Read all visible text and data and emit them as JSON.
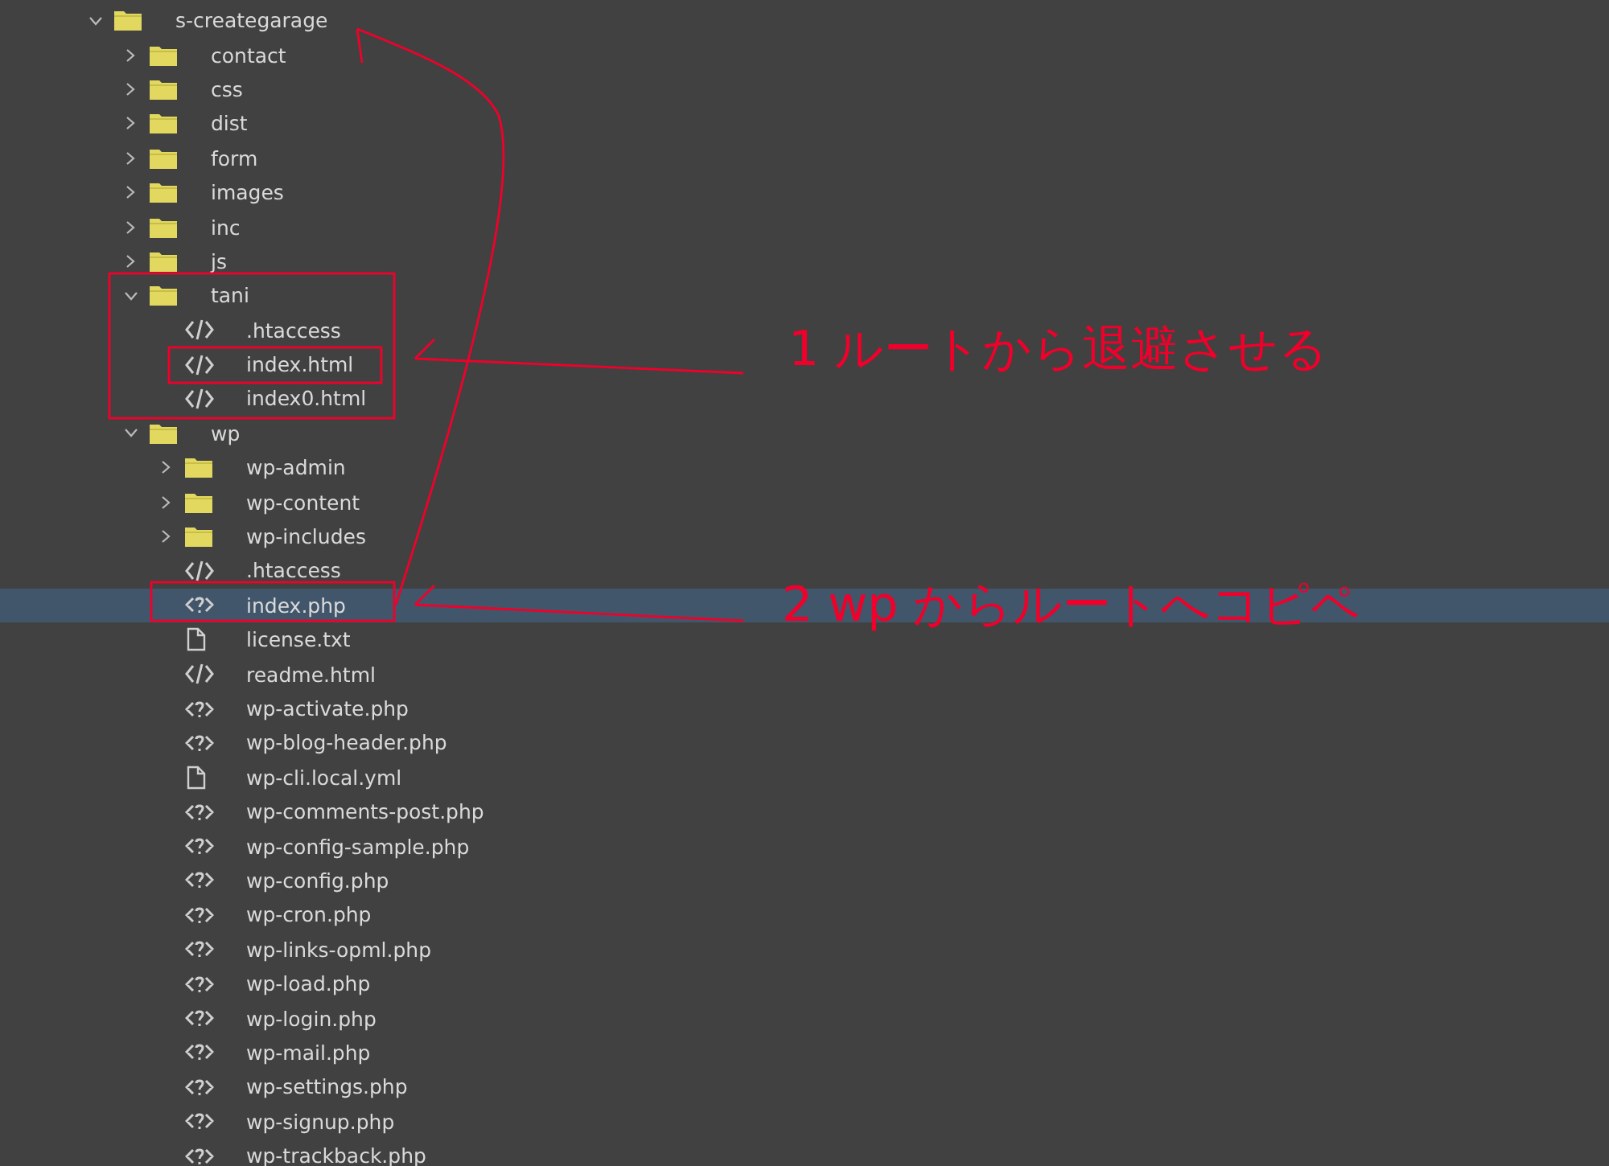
{
  "tree": [
    {
      "name": "s-creategarage",
      "kind": "folder",
      "expanded": true,
      "selected": false,
      "children": [
        {
          "name": "contact",
          "kind": "folder",
          "expanded": false,
          "selected": false
        },
        {
          "name": "css",
          "kind": "folder",
          "expanded": false,
          "selected": false
        },
        {
          "name": "dist",
          "kind": "folder",
          "expanded": false,
          "selected": false
        },
        {
          "name": "form",
          "kind": "folder",
          "expanded": false,
          "selected": false
        },
        {
          "name": "images",
          "kind": "folder",
          "expanded": false,
          "selected": false
        },
        {
          "name": "inc",
          "kind": "folder",
          "expanded": false,
          "selected": false
        },
        {
          "name": "js",
          "kind": "folder",
          "expanded": false,
          "selected": false
        },
        {
          "name": "tani",
          "kind": "folder",
          "expanded": true,
          "selected": false,
          "children": [
            {
              "name": ".htaccess",
              "kind": "markup",
              "selected": false
            },
            {
              "name": "index.html",
              "kind": "markup",
              "selected": false
            },
            {
              "name": "index0.html",
              "kind": "markup",
              "selected": false
            }
          ]
        },
        {
          "name": "wp",
          "kind": "folder",
          "expanded": true,
          "selected": false,
          "children": [
            {
              "name": "wp-admin",
              "kind": "folder",
              "expanded": false,
              "selected": false
            },
            {
              "name": "wp-content",
              "kind": "folder",
              "expanded": false,
              "selected": false
            },
            {
              "name": "wp-includes",
              "kind": "folder",
              "expanded": false,
              "selected": false
            },
            {
              "name": ".htaccess",
              "kind": "markup",
              "selected": false
            },
            {
              "name": "index.php",
              "kind": "php",
              "selected": true
            },
            {
              "name": "license.txt",
              "kind": "text",
              "selected": false
            },
            {
              "name": "readme.html",
              "kind": "markup",
              "selected": false
            },
            {
              "name": "wp-activate.php",
              "kind": "php",
              "selected": false
            },
            {
              "name": "wp-blog-header.php",
              "kind": "php",
              "selected": false
            },
            {
              "name": "wp-cli.local.yml",
              "kind": "text",
              "selected": false
            },
            {
              "name": "wp-comments-post.php",
              "kind": "php",
              "selected": false
            },
            {
              "name": "wp-config-sample.php",
              "kind": "php",
              "selected": false
            },
            {
              "name": "wp-config.php",
              "kind": "php",
              "selected": false
            },
            {
              "name": "wp-cron.php",
              "kind": "php",
              "selected": false
            },
            {
              "name": "wp-links-opml.php",
              "kind": "php",
              "selected": false
            },
            {
              "name": "wp-load.php",
              "kind": "php",
              "selected": false
            },
            {
              "name": "wp-login.php",
              "kind": "php",
              "selected": false
            },
            {
              "name": "wp-mail.php",
              "kind": "php",
              "selected": false
            },
            {
              "name": "wp-settings.php",
              "kind": "php",
              "selected": false
            },
            {
              "name": "wp-signup.php",
              "kind": "php",
              "selected": false
            },
            {
              "name": "wp-trackback.php",
              "kind": "php",
              "selected": false
            }
          ]
        }
      ]
    }
  ],
  "annotations": [
    {
      "text": "1 ルートから退避させる"
    },
    {
      "text": "2 wp からルートへコピペ"
    }
  ]
}
